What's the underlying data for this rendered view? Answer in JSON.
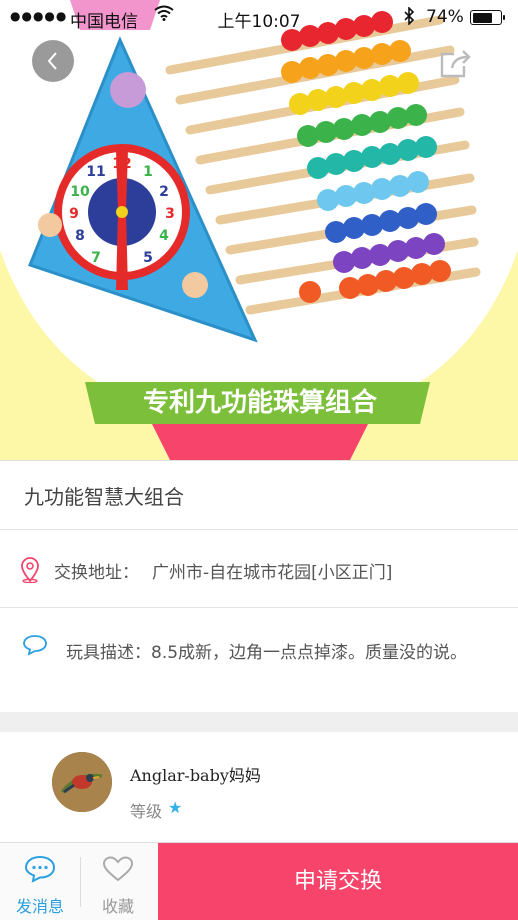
{
  "status_bar": {
    "signal": "●●●●●",
    "carrier": "中国电信",
    "time": "上午10:07",
    "bluetooth_icon": "bluetooth-icon",
    "battery_percent": "74%",
    "battery_level": 0.74
  },
  "hero": {
    "banner_text": "专利九功能珠算组合",
    "colors": {
      "banner_green": "#7cbf3a",
      "banner_pink": "#f6446b",
      "toy_blue": "#3ea9e3"
    }
  },
  "item": {
    "title": "九功能智慧大组合"
  },
  "address": {
    "icon": "location-pin-icon",
    "label": "交换地址：",
    "value": "广州市-自在城市花园[小区正门]"
  },
  "description": {
    "icon": "chat-bubble-icon",
    "text": "玩具描述：8.5成新，边角一点点掉漆。质量没的说。"
  },
  "user": {
    "name": "Anglar-baby妈妈",
    "level_label": "等级",
    "level_icon": "star-icon"
  },
  "bottom_bar": {
    "message_label": "发消息",
    "favorite_label": "收藏",
    "apply_label": "申请交换"
  },
  "colors": {
    "accent_blue": "#2ba0e0",
    "apply_pink": "#f6446b"
  }
}
